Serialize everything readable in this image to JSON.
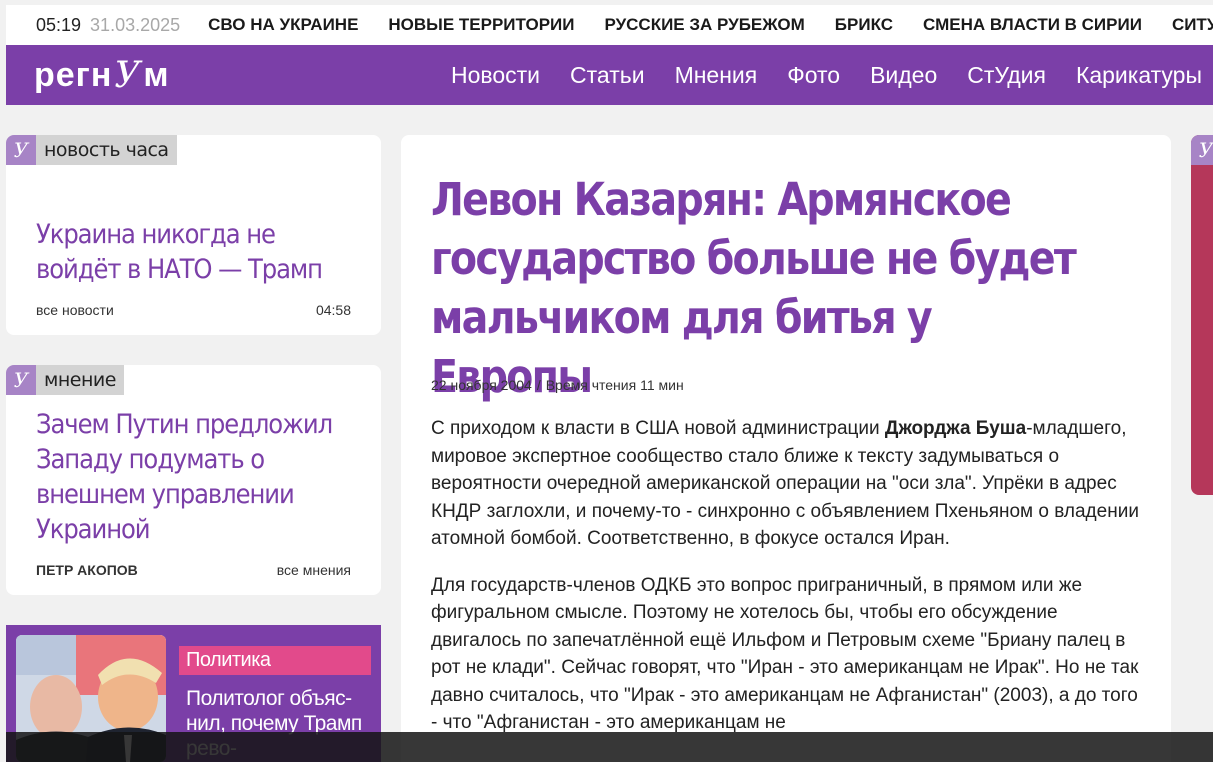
{
  "topbar": {
    "time": "05:19",
    "date": "31.03.2025",
    "tags": [
      "СВО НА УКРАИНЕ",
      "НОВЫЕ ТЕРРИТОРИИ",
      "РУССКИЕ ЗА РУБЕЖОМ",
      "БРИКС",
      "СМЕНА ВЛАСТИ В СИРИИ",
      "СИТУ"
    ]
  },
  "header": {
    "logo_left": "регн",
    "logo_mid": "У",
    "logo_right": "м",
    "nav": [
      "Новости",
      "Статьи",
      "Мнения",
      "Фото",
      "Видео",
      "СтУдия",
      "Карикатуры"
    ]
  },
  "colors": {
    "brand": "#7b3fa8",
    "accent_pink": "#e24a8b",
    "badge_mark": "#a784c6"
  },
  "news_hour": {
    "badge": "новость часа",
    "title": "Украина никогда не войдёт в НАТО — Трамп",
    "link": "все новости",
    "time": "04:58"
  },
  "opinion": {
    "badge": "мнение",
    "title": "Зачем Путин предложил Западу подумать о внешнем управлении Украиной",
    "author": "ПЕТР АКОПОВ",
    "link": "все мнения"
  },
  "politics": {
    "tag": "Политика",
    "title": "Политолог объяс-нил, почему Трамп рево-"
  },
  "article": {
    "title": "Левон Казарян: Армянское государство больше не будет мальчиком для битья у Европы",
    "date": "22 ноября 2004",
    "sep": "/",
    "read_time": "Время чтения 11 мин",
    "p1_before": "С приходом к власти в США новой администрации ",
    "p1_bold": "Джорджа Буша",
    "p1_after": "-младшего, мировое экспертное сообщество стало ближе к тексту задумываться о вероятности очередной американской операции на \"оси зла\". Упрёки в адрес КНДР заглохли, и почему-то - синхронно с объявлением Пхеньяном о владении атомной бомбой. Соответственно, в фокусе остался Иран.",
    "p2": "Для государств-членов ОДКБ это вопрос приграничный, в прямом или же фигуральном смысле. Поэтому не хотелось бы, чтобы его обсуждение двигалось по запечатлённой ещё Ильфом и Петровым схеме \"Бриану палец в рот не клади\". Сейчас говорят, что \"Иран - это американцам не Ирак\". Но не так давно считалось, что \"Ирак - это американцам не Афганистан\" (2003), а до того - что \"Афганистан - это американцам не"
  },
  "icons": {
    "badge_mark": "regnum-y-mark"
  }
}
